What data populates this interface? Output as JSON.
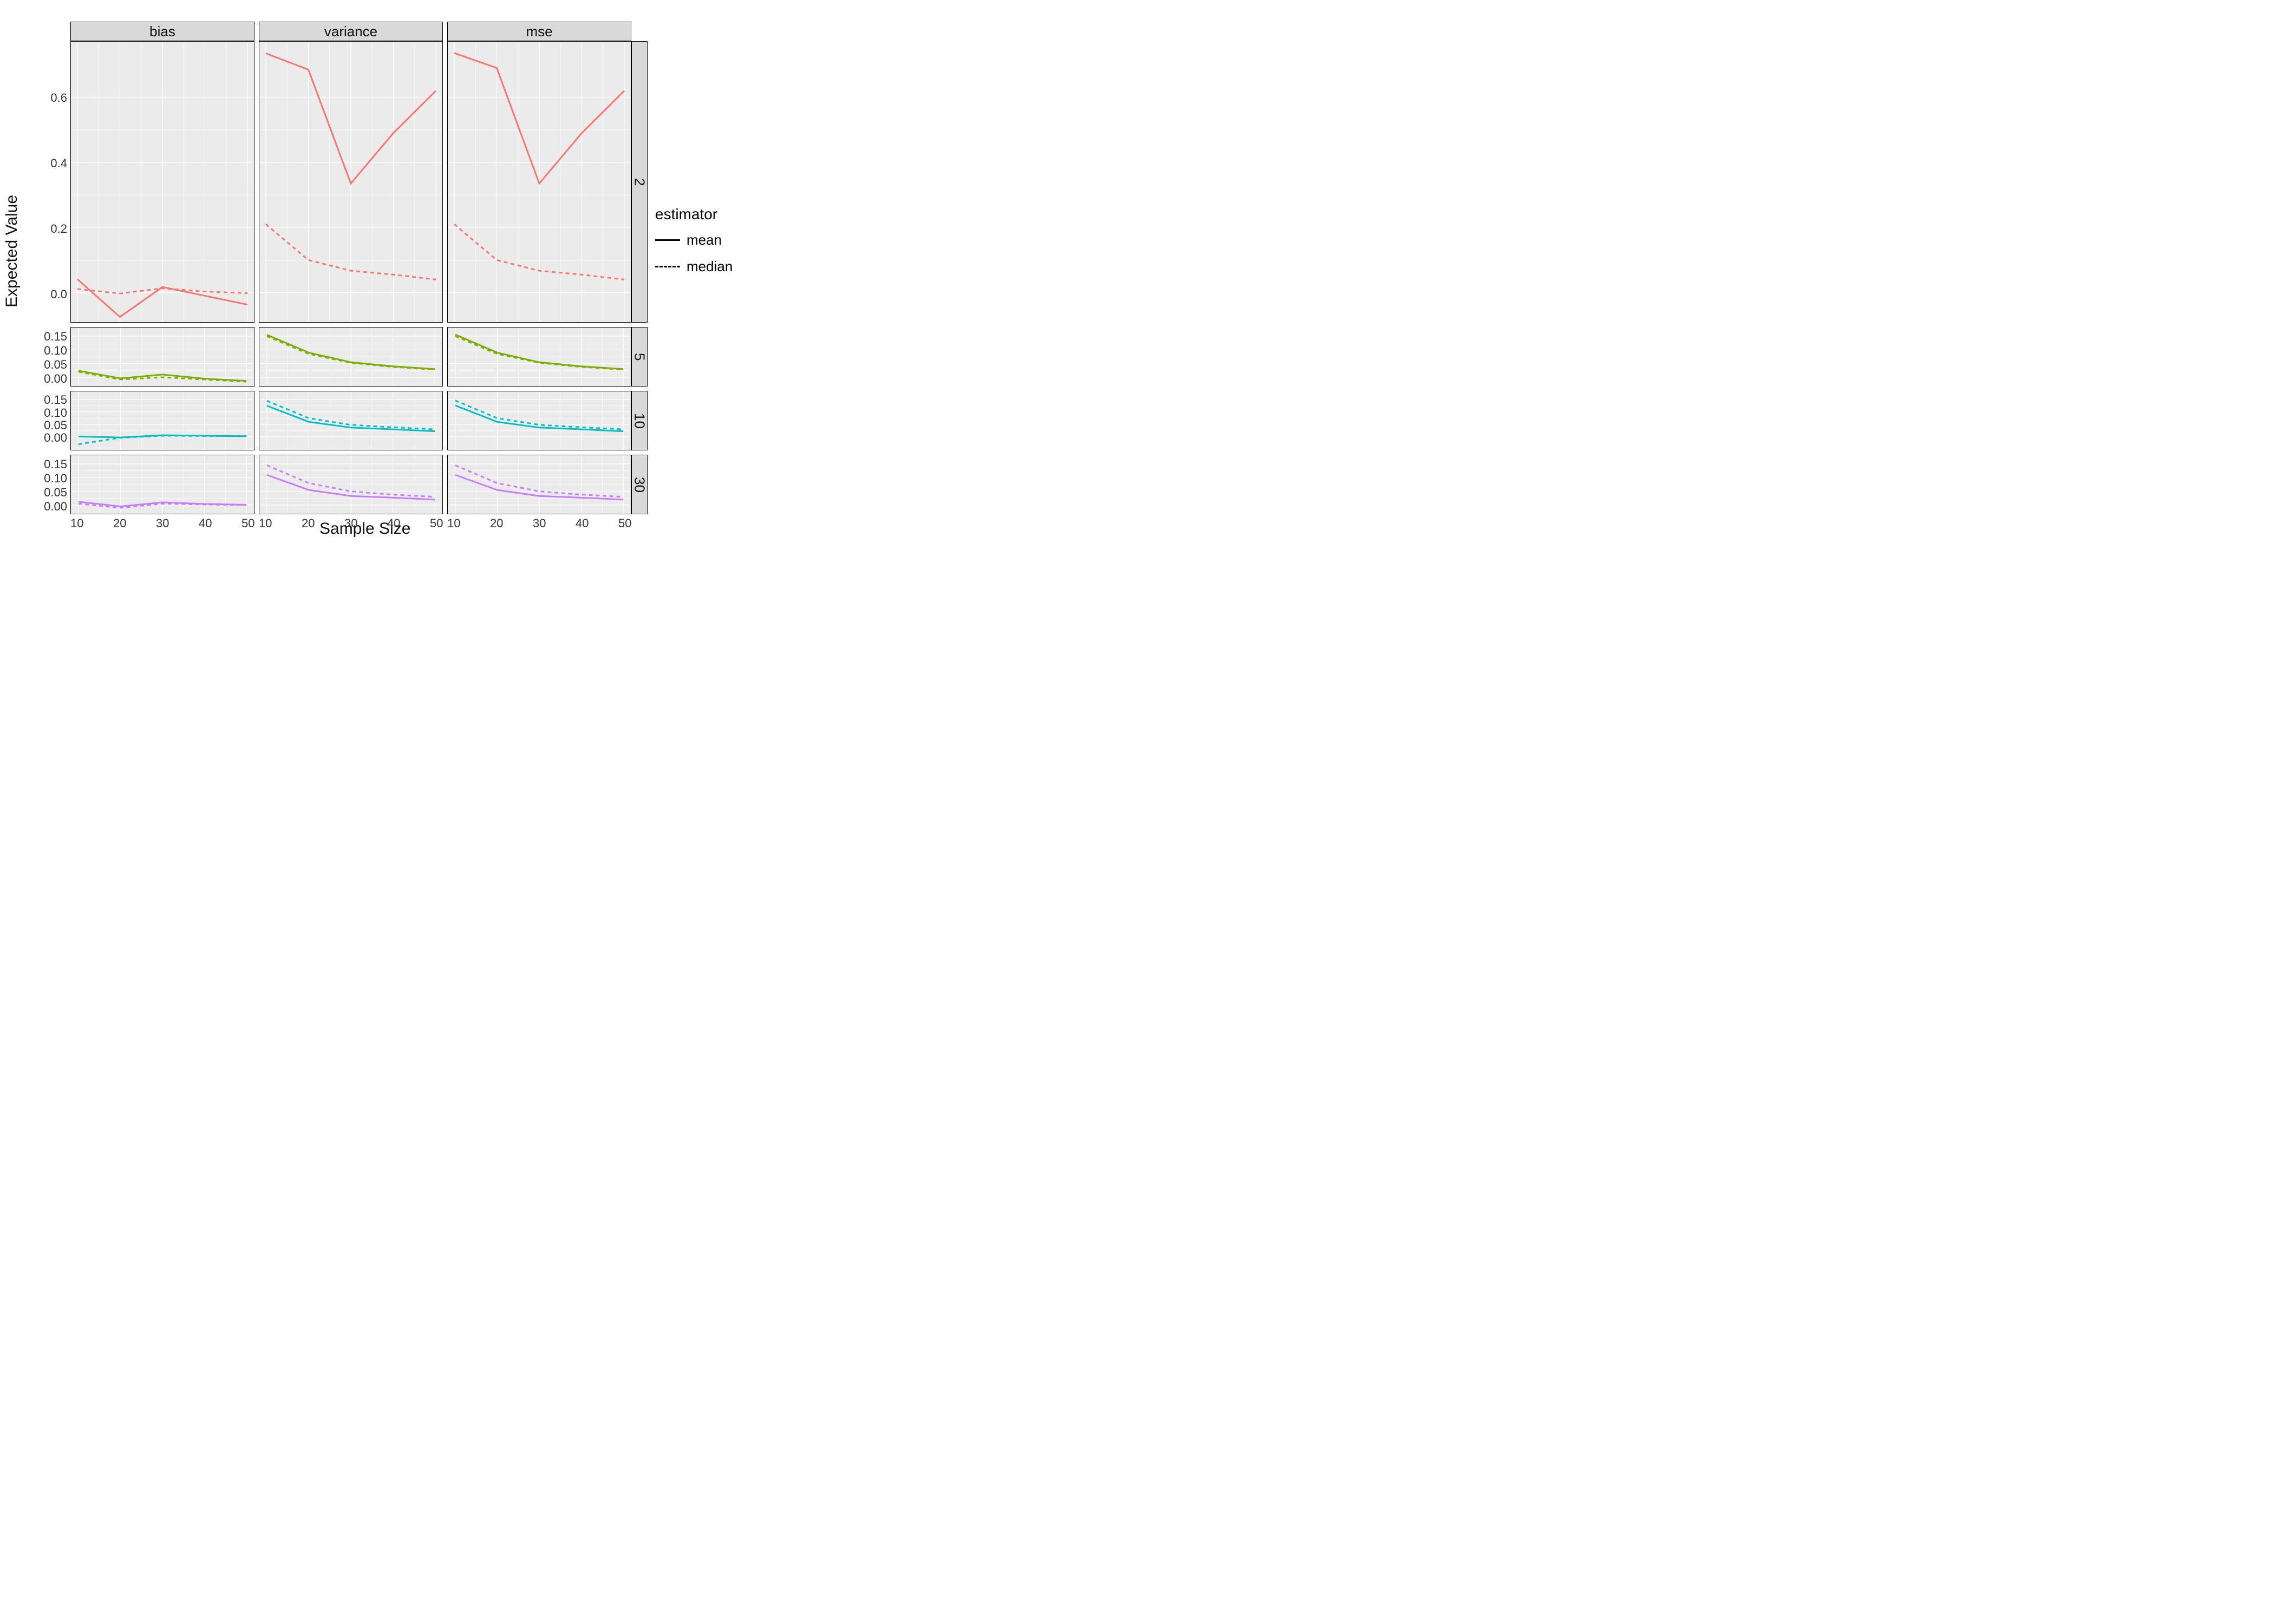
{
  "ylabel": "Expected Value",
  "xlabel": "Sample Size",
  "legend": {
    "title": "estimator",
    "items": [
      {
        "label": "mean",
        "dash": false
      },
      {
        "label": "median",
        "dash": true
      }
    ]
  },
  "cols": [
    "bias",
    "variance",
    "mse"
  ],
  "rows": [
    "2",
    "5",
    "10",
    "30"
  ],
  "x_ticks": [
    10,
    20,
    30,
    40,
    50
  ],
  "row_y": {
    "2": {
      "ticks": [
        0.0,
        0.2,
        0.4,
        0.6
      ]
    },
    "5": {
      "ticks": [
        0.0,
        0.05,
        0.1,
        0.15
      ]
    },
    "10": {
      "ticks": [
        0.0,
        0.05,
        0.1,
        0.15
      ]
    },
    "30": {
      "ticks": [
        0.0,
        0.05,
        0.1,
        0.15
      ]
    }
  },
  "colors": {
    "2": "#F8766D",
    "5": "#7CAE00",
    "10": "#00BFC4",
    "30": "#C77CFF"
  },
  "chart_data": {
    "type": "line",
    "x": [
      10,
      20,
      30,
      40,
      50
    ],
    "facet_columns": [
      "bias",
      "variance",
      "mse"
    ],
    "facet_rows": [
      "2",
      "5",
      "10",
      "30"
    ],
    "xlabel": "Sample Size",
    "ylabel": "Expected Value",
    "legend": "estimator",
    "rows": {
      "2": {
        "ylim": [
          -0.08,
          0.76
        ],
        "panels": {
          "bias": {
            "mean": [
              0.041,
              -0.075,
              0.017,
              -0.01,
              -0.037
            ],
            "median": [
              0.011,
              -0.003,
              0.013,
              0.003,
              -0.002
            ]
          },
          "variance": {
            "mean": [
              0.735,
              0.685,
              0.335,
              0.49,
              0.62
            ],
            "median": [
              0.21,
              0.1,
              0.067,
              0.055,
              0.04
            ]
          },
          "mse": {
            "mean": [
              0.736,
              0.69,
              0.335,
              0.49,
              0.62
            ],
            "median": [
              0.21,
              0.1,
              0.067,
              0.055,
              0.04
            ]
          }
        }
      },
      "5": {
        "ylim": [
          -0.02,
          0.17
        ],
        "panels": {
          "bias": {
            "mean": [
              0.024,
              -0.004,
              0.01,
              -0.005,
              -0.013
            ],
            "median": [
              0.02,
              -0.008,
              0.0,
              -0.008,
              -0.016
            ]
          },
          "variance": {
            "mean": [
              0.155,
              0.09,
              0.055,
              0.04,
              0.03
            ],
            "median": [
              0.15,
              0.085,
              0.053,
              0.038,
              0.028
            ]
          },
          "mse": {
            "mean": [
              0.156,
              0.09,
              0.055,
              0.04,
              0.03
            ],
            "median": [
              0.15,
              0.085,
              0.053,
              0.038,
              0.028
            ]
          }
        }
      },
      "10": {
        "ylim": [
          -0.04,
          0.17
        ],
        "panels": {
          "bias": {
            "mean": [
              0.001,
              -0.003,
              0.006,
              0.004,
              0.002
            ],
            "median": [
              -0.03,
              -0.004,
              0.004,
              0.003,
              0.003
            ]
          },
          "variance": {
            "mean": [
              0.125,
              0.06,
              0.037,
              0.03,
              0.022
            ],
            "median": [
              0.145,
              0.075,
              0.048,
              0.038,
              0.03
            ]
          },
          "mse": {
            "mean": [
              0.126,
              0.06,
              0.037,
              0.03,
              0.022
            ],
            "median": [
              0.146,
              0.075,
              0.048,
              0.038,
              0.03
            ]
          }
        }
      },
      "30": {
        "ylim": [
          -0.02,
          0.17
        ],
        "panels": {
          "bias": {
            "mean": [
              0.012,
              -0.005,
              0.01,
              0.004,
              0.001
            ],
            "median": [
              0.005,
              -0.01,
              0.005,
              0.002,
              0.0
            ]
          },
          "variance": {
            "mean": [
              0.11,
              0.055,
              0.033,
              0.027,
              0.02
            ],
            "median": [
              0.145,
              0.08,
              0.05,
              0.038,
              0.03
            ]
          },
          "mse": {
            "mean": [
              0.11,
              0.055,
              0.033,
              0.027,
              0.02
            ],
            "median": [
              0.145,
              0.08,
              0.05,
              0.038,
              0.03
            ]
          }
        }
      }
    }
  }
}
